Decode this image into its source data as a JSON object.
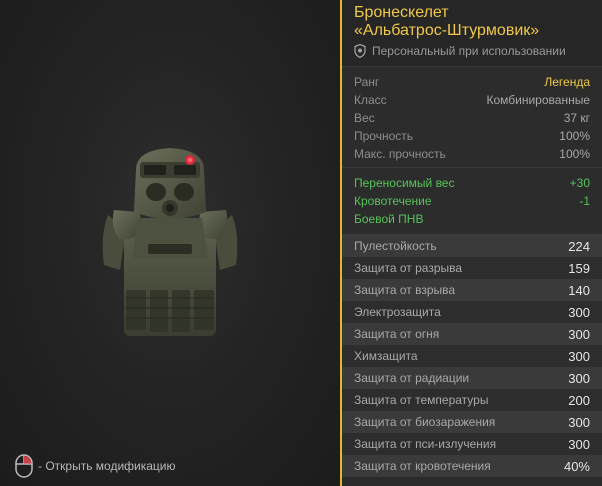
{
  "item": {
    "title_line1": "Бронескелет",
    "title_line2": "«Альбатрос-Штурмовик»",
    "subtitle": "Персональный при использовании",
    "accent_color": "#efc84a"
  },
  "properties": [
    {
      "name": "Ранг",
      "value": "Легенда"
    },
    {
      "name": "Класс",
      "value": "Комбинированные"
    },
    {
      "name": "Вес",
      "value": "37 кг"
    },
    {
      "name": "Прочность",
      "value": "100%"
    },
    {
      "name": "Макс. прочность",
      "value": "100%"
    }
  ],
  "bonuses": [
    {
      "name": "Переносимый вес",
      "value": "+30"
    },
    {
      "name": "Кровотечение",
      "value": "-1"
    },
    {
      "name": "Боевой ПНВ",
      "value": ""
    }
  ],
  "stats": [
    {
      "name": "Пулестойкость",
      "value": "224"
    },
    {
      "name": "Защита от разрыва",
      "value": "159"
    },
    {
      "name": "Защита от взрыва",
      "value": "140"
    },
    {
      "name": "Электрозащита",
      "value": "300"
    },
    {
      "name": "Защита от огня",
      "value": "300"
    },
    {
      "name": "Химзащита",
      "value": "300"
    },
    {
      "name": "Защита от радиации",
      "value": "300"
    },
    {
      "name": "Защита от температуры",
      "value": "200"
    },
    {
      "name": "Защита от биозаражения",
      "value": "300"
    },
    {
      "name": "Защита от пси-излучения",
      "value": "300"
    },
    {
      "name": "Защита от кровотечения",
      "value": "40%"
    }
  ],
  "hint": {
    "text": "- Открыть модификацию",
    "icon": "mouse-right-click-icon"
  }
}
